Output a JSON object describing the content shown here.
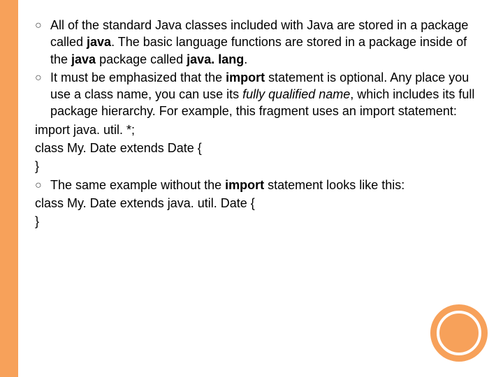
{
  "bullets": {
    "b1": {
      "t1": "All of the standard Java classes included with Java are stored in a package called ",
      "t2": "java",
      "t3": ". The basic language functions are stored in a package inside of the ",
      "t4": "java",
      "t5": " package called ",
      "t6": "java. lang",
      "t7": "."
    },
    "b2": {
      "t1": " It must be emphasized that the ",
      "t2": "import",
      "t3": " statement is optional. Any place you use a class name, you can use its ",
      "t4": "fully qualified name",
      "t5": ", which includes its full package hierarchy. For example, this fragment uses an import statement:"
    },
    "b3": {
      "t1": "The same example without the ",
      "t2": "import",
      "t3": " statement looks like this:"
    }
  },
  "code": {
    "c1": "import java. util. *;",
    "c2": "class My. Date extends Date {",
    "c3": "}",
    "c4": "class My. Date extends java. util. Date {",
    "c5": "}"
  },
  "glyph": "○"
}
